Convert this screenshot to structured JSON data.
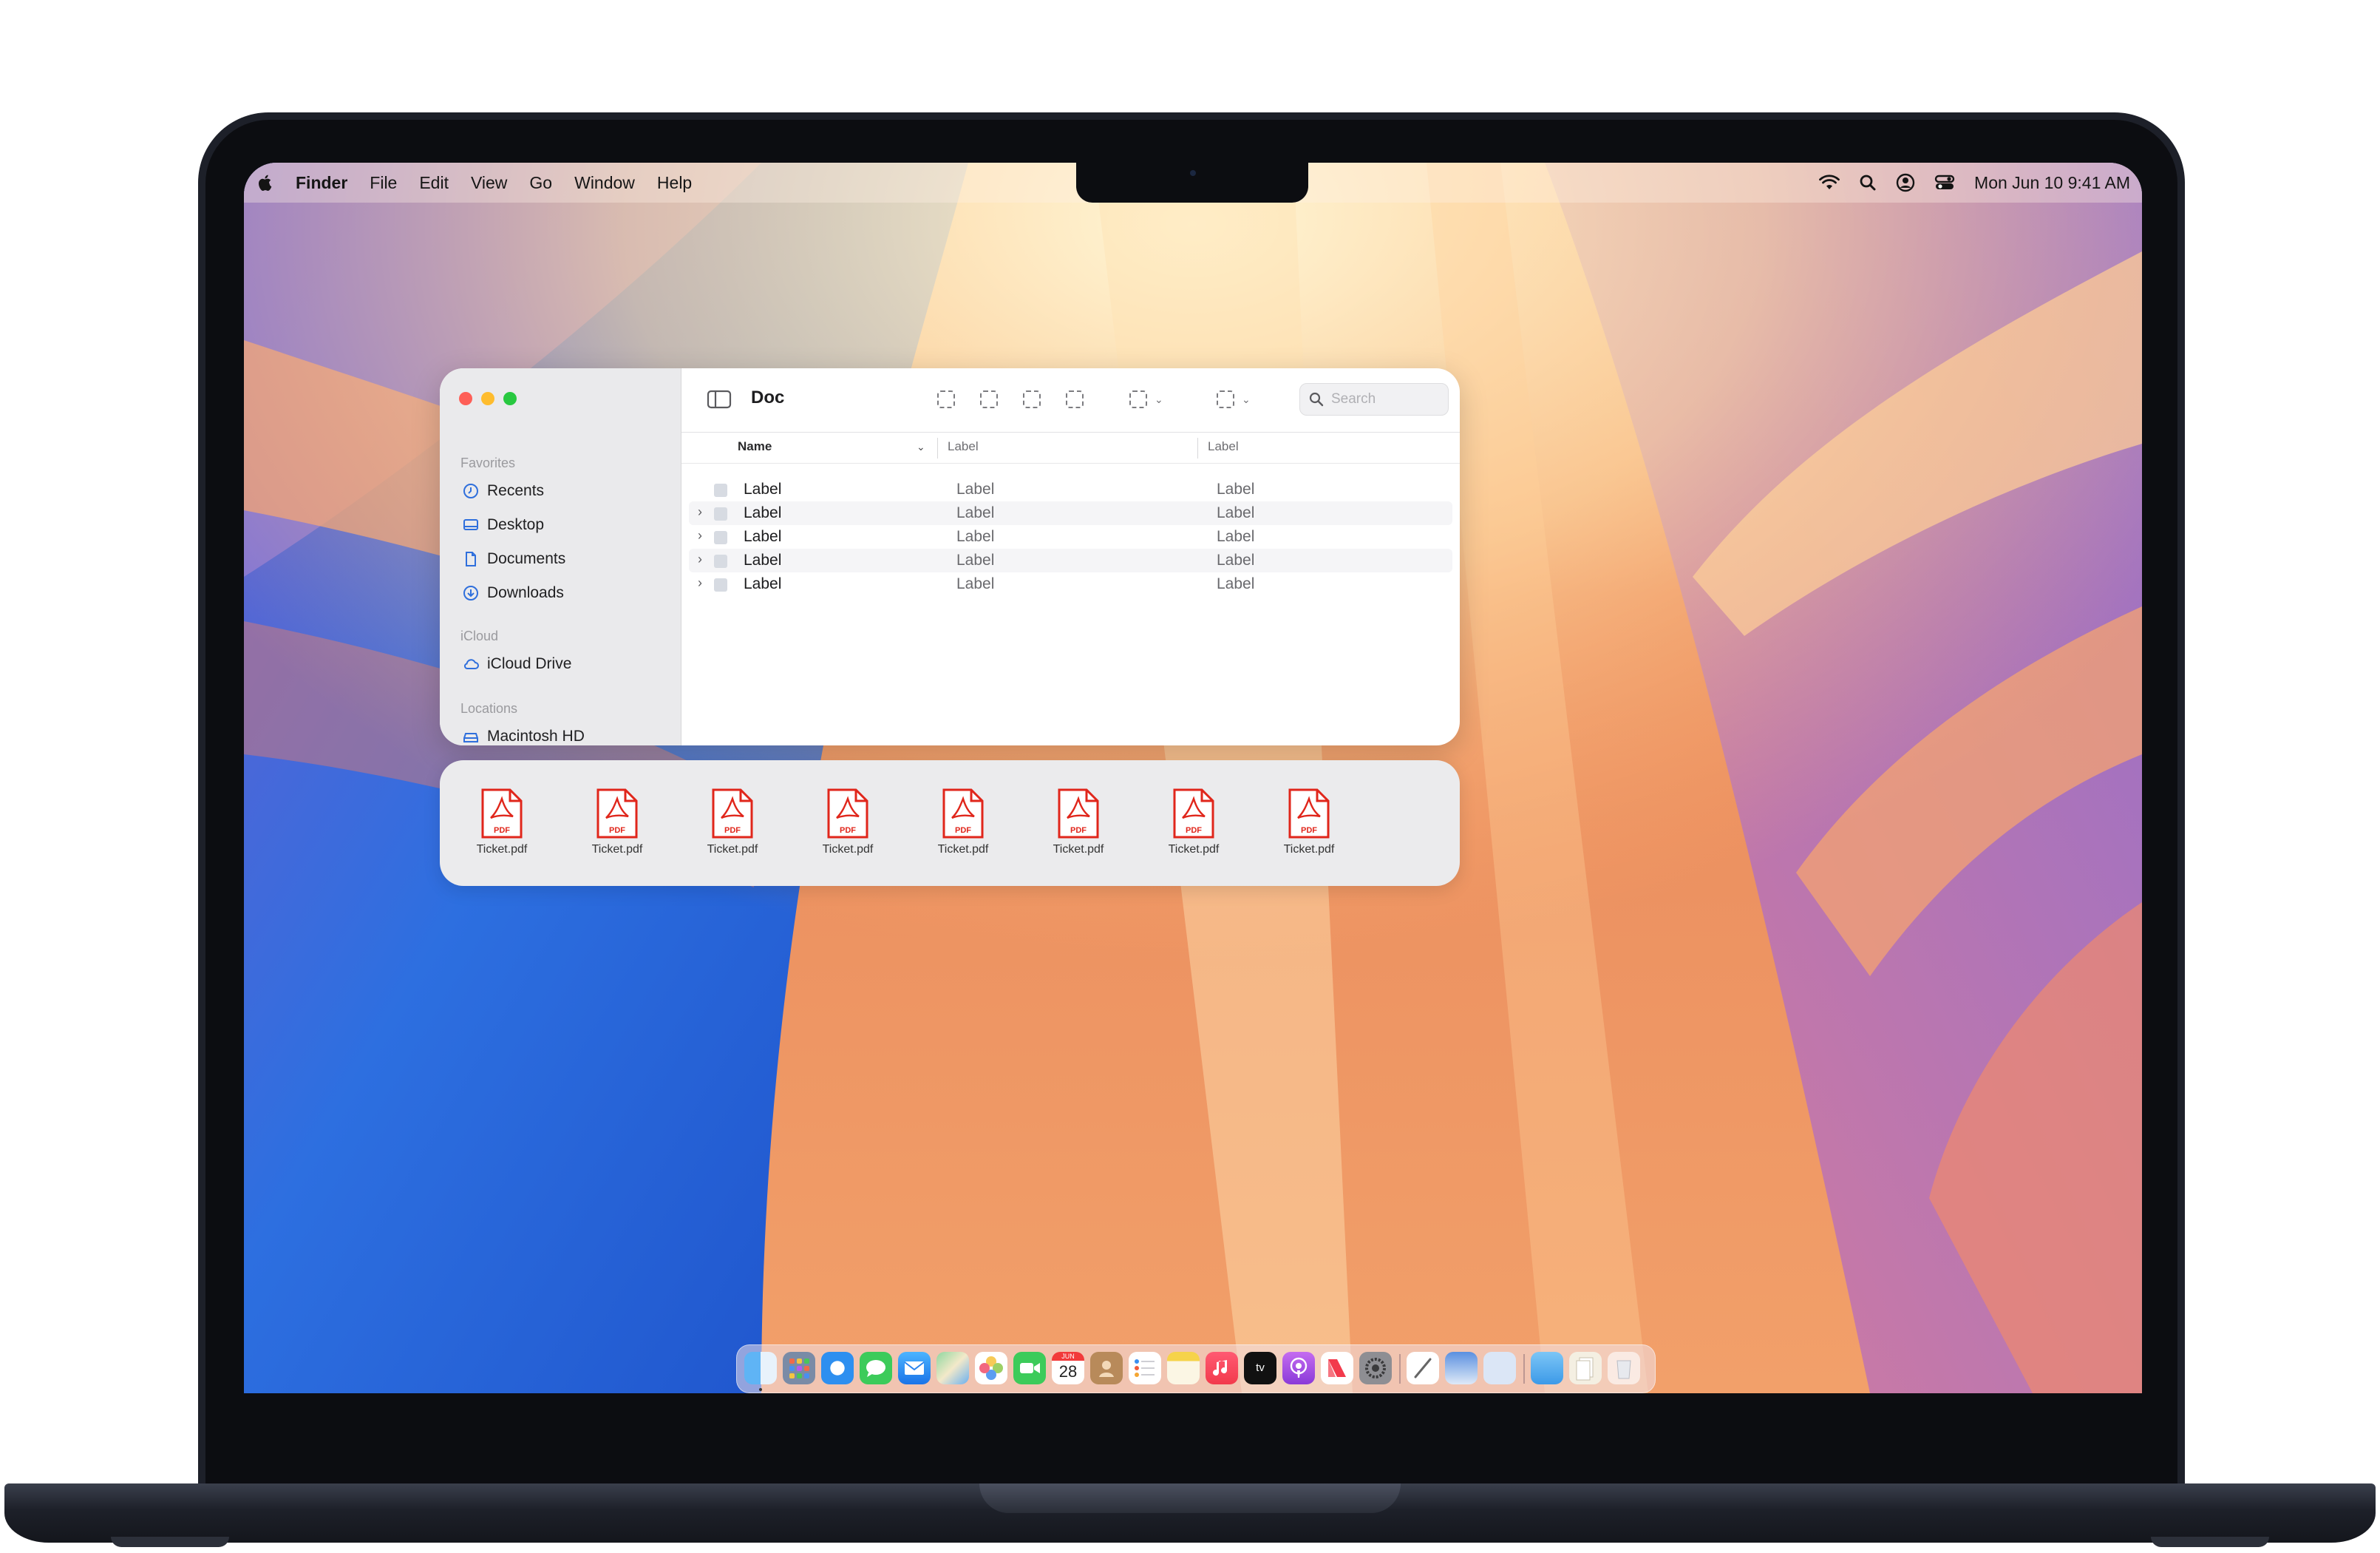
{
  "menubar": {
    "app_name": "Finder",
    "menus": [
      "File",
      "Edit",
      "View",
      "Go",
      "Window",
      "Help"
    ],
    "status_icons": [
      "wifi-icon",
      "search-icon",
      "user-icon",
      "control-center-icon"
    ],
    "clock": "Mon Jun 10  9:41 AM"
  },
  "finder": {
    "title": "Doc",
    "search_placeholder": "Search",
    "sidebar": {
      "favorites_header": "Favorites",
      "favorites": [
        {
          "label": "Recents",
          "icon": "clock-icon"
        },
        {
          "label": "Desktop",
          "icon": "desktop-icon"
        },
        {
          "label": "Documents",
          "icon": "document-icon"
        },
        {
          "label": "Downloads",
          "icon": "download-icon"
        }
      ],
      "icloud_header": "iCloud",
      "icloud": [
        {
          "label": "iCloud Drive",
          "icon": "cloud-icon"
        }
      ],
      "locations_header": "Locations",
      "locations": [
        {
          "label": "Macintosh HD",
          "icon": "drive-icon"
        }
      ]
    },
    "columns": [
      "Name",
      "Label",
      "Label"
    ],
    "rows": [
      {
        "name": "Label",
        "col2": "Label",
        "col3": "Label",
        "expandable": false
      },
      {
        "name": "Label",
        "col2": "Label",
        "col3": "Label",
        "expandable": true
      },
      {
        "name": "Label",
        "col2": "Label",
        "col3": "Label",
        "expandable": true
      },
      {
        "name": "Label",
        "col2": "Label",
        "col3": "Label",
        "expandable": true
      },
      {
        "name": "Label",
        "col2": "Label",
        "col3": "Label",
        "expandable": true
      }
    ]
  },
  "shelf": {
    "files": [
      "Ticket.pdf",
      "Ticket.pdf",
      "Ticket.pdf",
      "Ticket.pdf",
      "Ticket.pdf",
      "Ticket.pdf",
      "Ticket.pdf",
      "Ticket.pdf"
    ],
    "badge": "PDF"
  },
  "dock": {
    "calendar_month": "JUN",
    "calendar_day": "28",
    "tv_label": "tv",
    "apps": [
      "finder",
      "launchpad",
      "safari",
      "messages",
      "mail",
      "maps",
      "photos",
      "facetime",
      "calendar",
      "contacts",
      "reminders",
      "notes",
      "music",
      "tv",
      "podcasts",
      "news",
      "settings",
      "freeform",
      "preview",
      "blank",
      "folder",
      "documents",
      "trash"
    ]
  },
  "colors": {
    "close": "#fe5f57",
    "minimize": "#febc2e",
    "zoom": "#28c840",
    "pdf_red": "#e0261b",
    "accent": "#2f6fdc"
  }
}
